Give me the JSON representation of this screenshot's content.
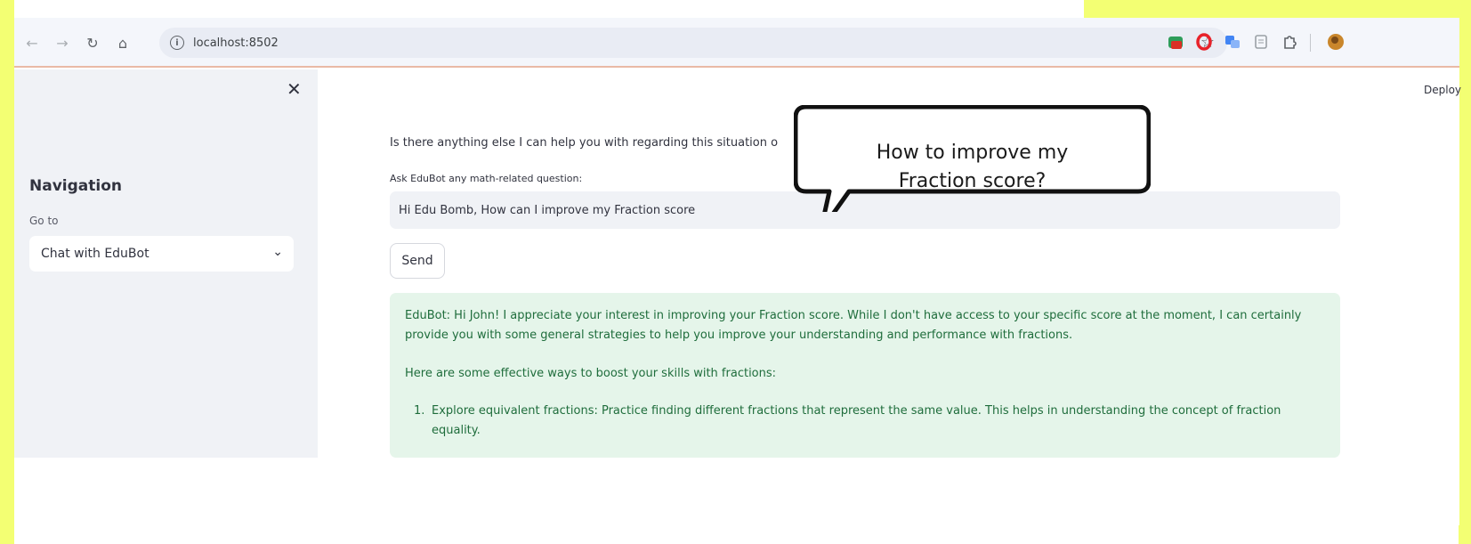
{
  "colors": {
    "frame": "#f3ff73",
    "accent_green_bg": "#e5f5ea",
    "accent_green_text": "#1f6d3c",
    "sidebar_bg": "#f0f2f6"
  },
  "browser": {
    "url": "localhost:8502",
    "icons": {
      "back": "arrow-left-icon",
      "forward": "arrow-right-icon",
      "reload": "reload-icon",
      "home": "home-icon",
      "info": "info-icon",
      "bookmark": "star-icon",
      "extensions": [
        "extension-icon",
        "opera-icon",
        "translate-icon",
        "reader-icon",
        "puzzle-icon",
        "profile-avatar-icon"
      ]
    }
  },
  "app": {
    "deploy_label": "Deploy"
  },
  "sidebar": {
    "title": "Navigation",
    "goto_label": "Go to",
    "selected_page": "Chat with EduBot"
  },
  "chat": {
    "previous_text": "Is there anything else I can help you with regarding this situation o",
    "input_label": "Ask EduBot any math-related question:",
    "input_value": "Hi Edu Bomb, How can I improve my Fraction score",
    "send_label": "Send",
    "response": {
      "paragraph1": "EduBot: Hi John! I appreciate your interest in improving your Fraction score. While I don't have access to your specific score at the moment, I can certainly provide you with some general strategies to help you improve your understanding and performance with fractions.",
      "paragraph2": "Here are some effective ways to boost your skills with fractions:",
      "items": [
        {
          "number": "1.",
          "text": "Explore equivalent fractions: Practice finding different fractions that represent the same value. This helps in understanding the concept of fraction equality."
        }
      ]
    }
  },
  "callout": {
    "line1": "How to improve my",
    "line2": "Fraction score?"
  }
}
